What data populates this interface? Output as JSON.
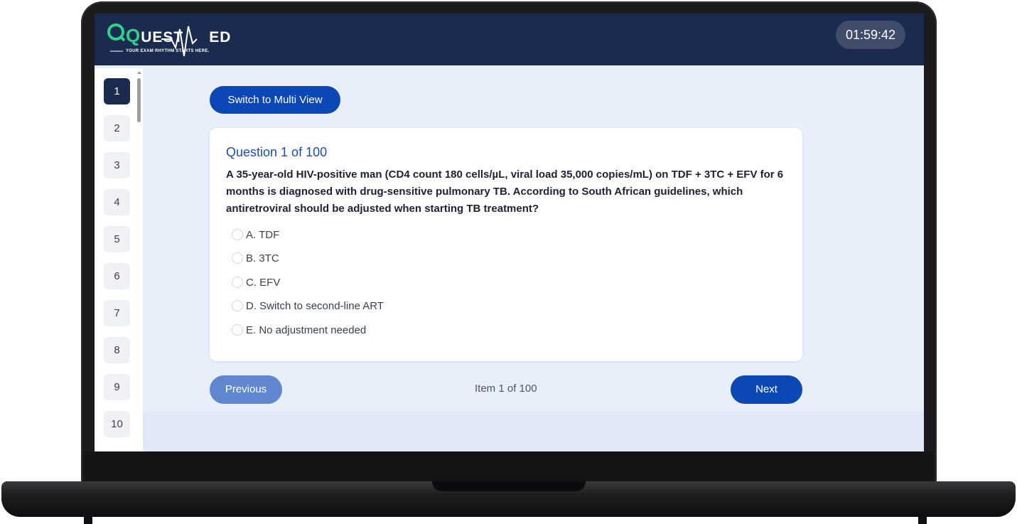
{
  "app": {
    "logo_text_q": "Q",
    "logo_text_uest": "UEST",
    "logo_text_ed": "ED",
    "logo_tagline": "YOUR EXAM RHYTHM STARTS HERE.",
    "timer": "01:59:42"
  },
  "sidebar": {
    "items": [
      {
        "label": "1",
        "active": true
      },
      {
        "label": "2"
      },
      {
        "label": "3"
      },
      {
        "label": "4"
      },
      {
        "label": "5"
      },
      {
        "label": "6"
      },
      {
        "label": "7"
      },
      {
        "label": "8"
      },
      {
        "label": "9"
      },
      {
        "label": "10"
      }
    ]
  },
  "toolbar": {
    "switch_view_label": "Switch to Multi View"
  },
  "question": {
    "title": "Question 1 of 100",
    "text": "A 35-year-old HIV-positive man (CD4 count 180 cells/µL, viral load 35,000 copies/mL) on TDF + 3TC + EFV for 6 months is diagnosed with drug-sensitive pulmonary TB. According to South African guidelines, which antiretroviral should be adjusted when starting TB treatment?",
    "options": [
      {
        "label": "A. TDF"
      },
      {
        "label": "B. 3TC"
      },
      {
        "label": "C. EFV"
      },
      {
        "label": "D. Switch to second-line ART"
      },
      {
        "label": "E. No adjustment needed"
      }
    ]
  },
  "navigation": {
    "previous_label": "Previous",
    "status": "Item 1 of 100",
    "next_label": "Next"
  },
  "colors": {
    "header_bg": "#1a2b4f",
    "accent_blue": "#0b48b6",
    "brand_green": "#2fd08a",
    "question_title": "#1c4fae"
  },
  "icons": {
    "logo": "heartbeat-line-logo"
  }
}
